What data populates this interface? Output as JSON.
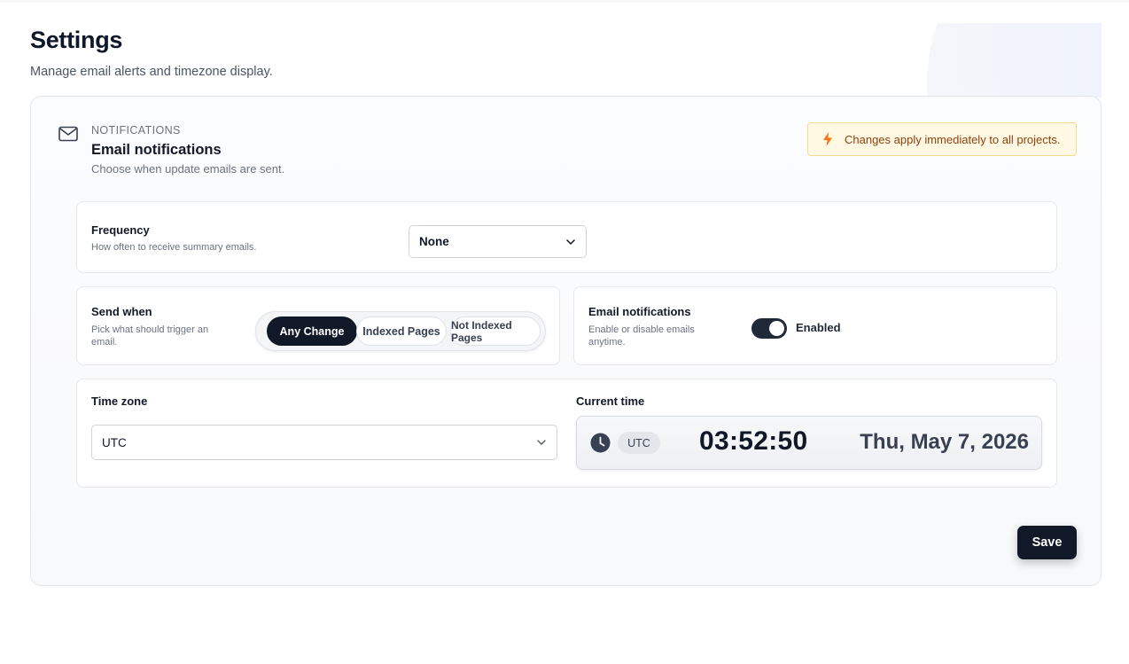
{
  "page": {
    "title": "Settings",
    "subtitle": "Manage email alerts and timezone display."
  },
  "section": {
    "kicker": "NOTIFICATIONS",
    "title": "Email notifications",
    "description": "Choose when update emails are sent.",
    "icon": "mail-icon"
  },
  "notice": {
    "text": "Changes apply immediately to all projects.",
    "icon": "lightning-icon"
  },
  "frequency": {
    "label": "Frequency",
    "hint": "How often to receive summary emails.",
    "selected": "None"
  },
  "send_when": {
    "label": "Send when",
    "hint": "Pick what should trigger an email.",
    "options": [
      "Any Change",
      "Indexed Pages",
      "Not Indexed Pages"
    ],
    "active_index": 0
  },
  "email_toggle": {
    "label": "Email notifications",
    "hint": "Enable or disable emails anytime.",
    "state_label": "Enabled",
    "on": true
  },
  "timezone": {
    "label": "Time zone",
    "selected": "UTC"
  },
  "current_time": {
    "label": "Current time",
    "zone_chip": "UTC",
    "time": "03:52:50",
    "date": "Thu, May 7, 2026"
  },
  "actions": {
    "save_label": "Save"
  },
  "colors": {
    "primary": "#111827",
    "notice_bg": "#fff9e3",
    "notice_border": "#f5dd8f",
    "notice_icon": "#f97316"
  }
}
